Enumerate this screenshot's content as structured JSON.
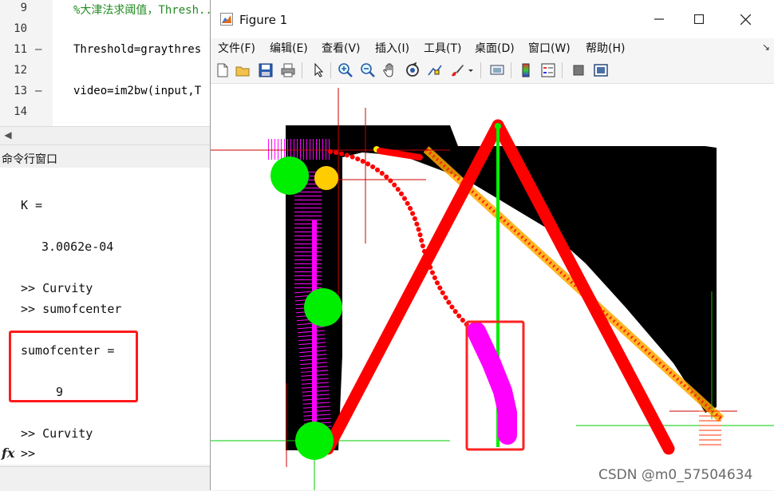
{
  "editor": {
    "lines": [
      {
        "num": "9",
        "dash": "",
        "text": "%大津法求阈值，Thresh...阈值",
        "comment": true
      },
      {
        "num": "10",
        "dash": "",
        "text": "",
        "comment": false
      },
      {
        "num": "11",
        "dash": "—",
        "text": "Threshold=graythres",
        "comment": false
      },
      {
        "num": "12",
        "dash": "",
        "text": "",
        "comment": false
      },
      {
        "num": "13",
        "dash": "—",
        "text": "video=im2bw(input,T",
        "comment": false
      },
      {
        "num": "14",
        "dash": "",
        "text": "",
        "comment": false
      }
    ]
  },
  "command_window": {
    "title": "命令行窗口",
    "lines": [
      "K =",
      "3.0062e-04",
      ">> Curvity",
      ">> sumofcenter",
      "sumofcenter =",
      "9",
      ">> Curvity",
      ">>"
    ],
    "fx_label": "fx"
  },
  "figure": {
    "title": "Figure 1",
    "menu": [
      "文件(F)",
      "编辑(E)",
      "查看(V)",
      "插入(I)",
      "工具(T)",
      "桌面(D)",
      "窗口(W)",
      "帮助(H)"
    ],
    "toolbar_icons": [
      "new-figure-icon",
      "open-file-icon",
      "save-icon",
      "print-icon",
      "pointer-icon",
      "zoom-in-icon",
      "zoom-out-icon",
      "pan-icon",
      "rotate-3d-icon",
      "data-cursor-icon",
      "brush-icon",
      "link-plot-icon",
      "colorbar-icon",
      "legend-icon",
      "hide-plot-tools-icon",
      "show-plot-tools-icon"
    ],
    "colors": {
      "red": "#ff0000",
      "magenta": "#ff00ff",
      "green": "#00ee00",
      "orange": "#ffa500"
    }
  },
  "watermark": "CSDN @m0_57504634"
}
